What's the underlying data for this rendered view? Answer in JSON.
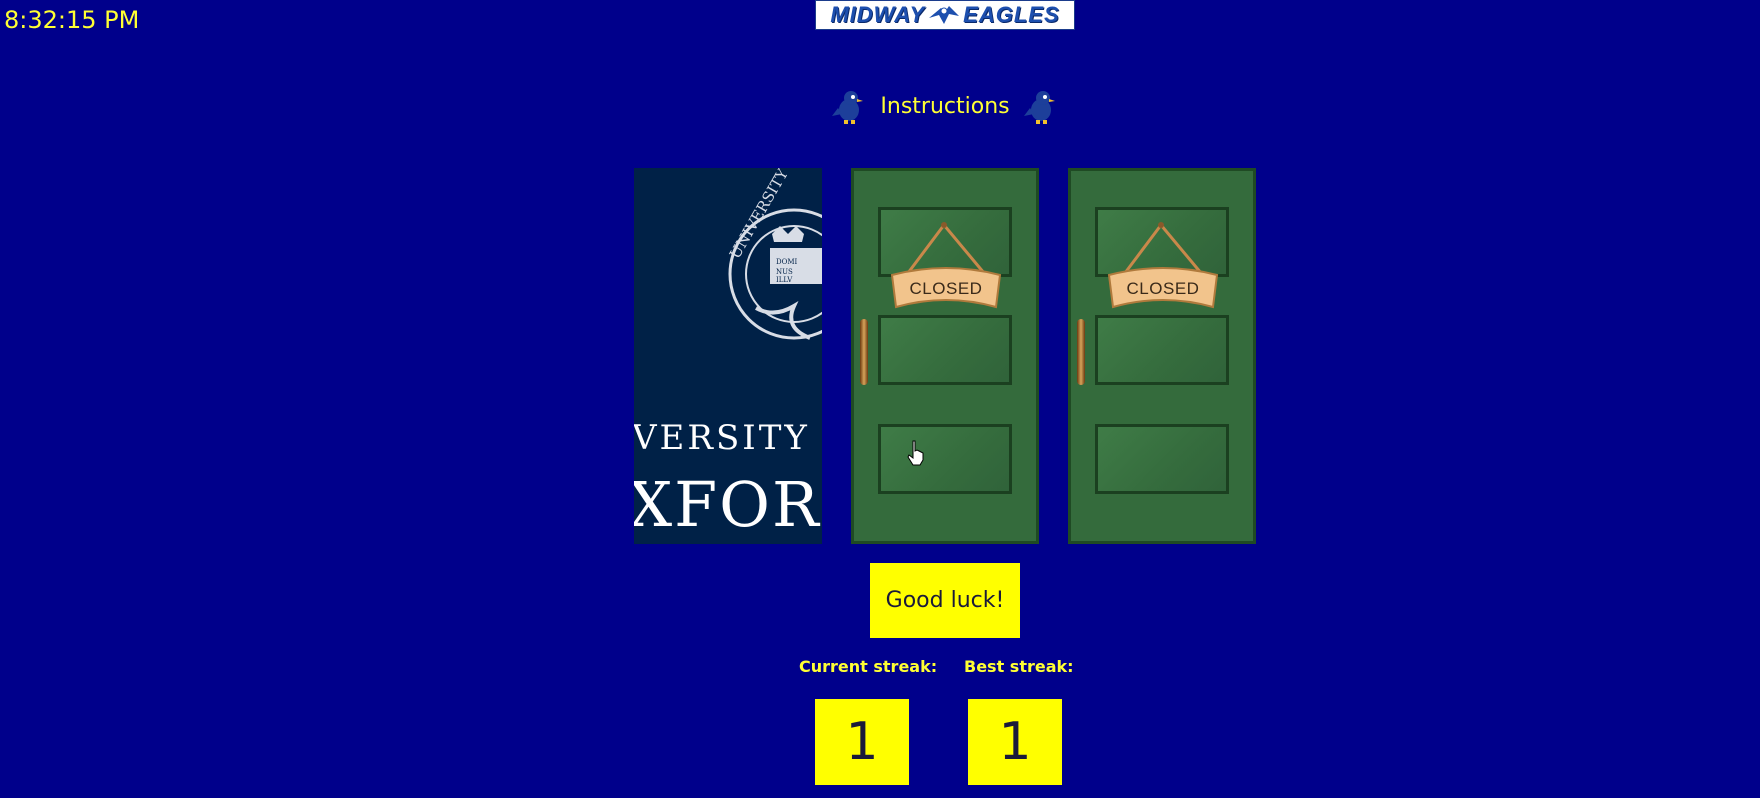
{
  "clock": {
    "time": "8:32:15 PM"
  },
  "header": {
    "logo_left": "MIDWAY",
    "logo_right": "EAGLES",
    "instructions_label": "Instructions"
  },
  "doors": [
    {
      "state": "opened",
      "content": "university-of-oxford-logo",
      "text_line1": "VERSITY OF",
      "text_line2": "XFOR"
    },
    {
      "state": "closed",
      "sign": "CLOSED"
    },
    {
      "state": "closed",
      "sign": "CLOSED"
    }
  ],
  "status": {
    "message": "Good luck!"
  },
  "stats": {
    "current_label": "Current streak:",
    "current_value": "1",
    "best_label": "Best streak:",
    "best_value": "1"
  },
  "colors": {
    "background": "#00008b",
    "accent_text": "#ffff33",
    "box_fill": "#ffff00",
    "door_green": "#346b3c",
    "oxford_navy": "#002147"
  }
}
